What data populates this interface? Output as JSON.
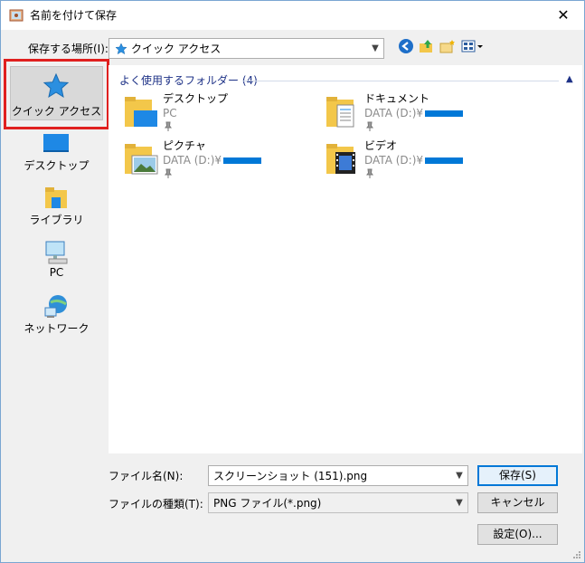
{
  "window": {
    "title": "名前を付けて保存",
    "close_icon": "close-icon"
  },
  "location": {
    "label": "保存する場所(I):",
    "value": "クイック アクセス"
  },
  "toolbar": {
    "icons": [
      "back-icon",
      "up-folder-icon",
      "new-folder-icon",
      "view-menu-icon"
    ]
  },
  "nav": {
    "items": [
      {
        "label": "クイック アクセス",
        "icon": "star-icon",
        "selected": true
      },
      {
        "label": "デスクトップ",
        "icon": "desktop-icon"
      },
      {
        "label": "ライブラリ",
        "icon": "library-icon"
      },
      {
        "label": "PC",
        "icon": "pc-icon"
      },
      {
        "label": "ネットワーク",
        "icon": "network-icon"
      }
    ]
  },
  "pane": {
    "group_header": "よく使用するフォルダー (4)",
    "folders": [
      {
        "name": "デスクトップ",
        "location": "PC",
        "redacted": false,
        "icon": "desktop-folder-icon"
      },
      {
        "name": "ドキュメント",
        "location": "DATA (D:)¥",
        "redacted": true,
        "icon": "documents-folder-icon"
      },
      {
        "name": "ピクチャ",
        "location": "DATA (D:)¥",
        "redacted": true,
        "icon": "pictures-folder-icon"
      },
      {
        "name": "ビデオ",
        "location": "DATA (D:)¥",
        "redacted": true,
        "icon": "videos-folder-icon"
      }
    ]
  },
  "form": {
    "filename_label": "ファイル名(N):",
    "filename_value": "スクリーンショット (151).png",
    "filetype_label": "ファイルの種類(T):",
    "filetype_value": "PNG ファイル(*.png)"
  },
  "buttons": {
    "save": "保存(S)",
    "cancel": "キャンセル",
    "settings": "設定(O)..."
  },
  "colors": {
    "accent": "#0078d7",
    "highlight": "#e0201f",
    "header": "#1e3287"
  }
}
